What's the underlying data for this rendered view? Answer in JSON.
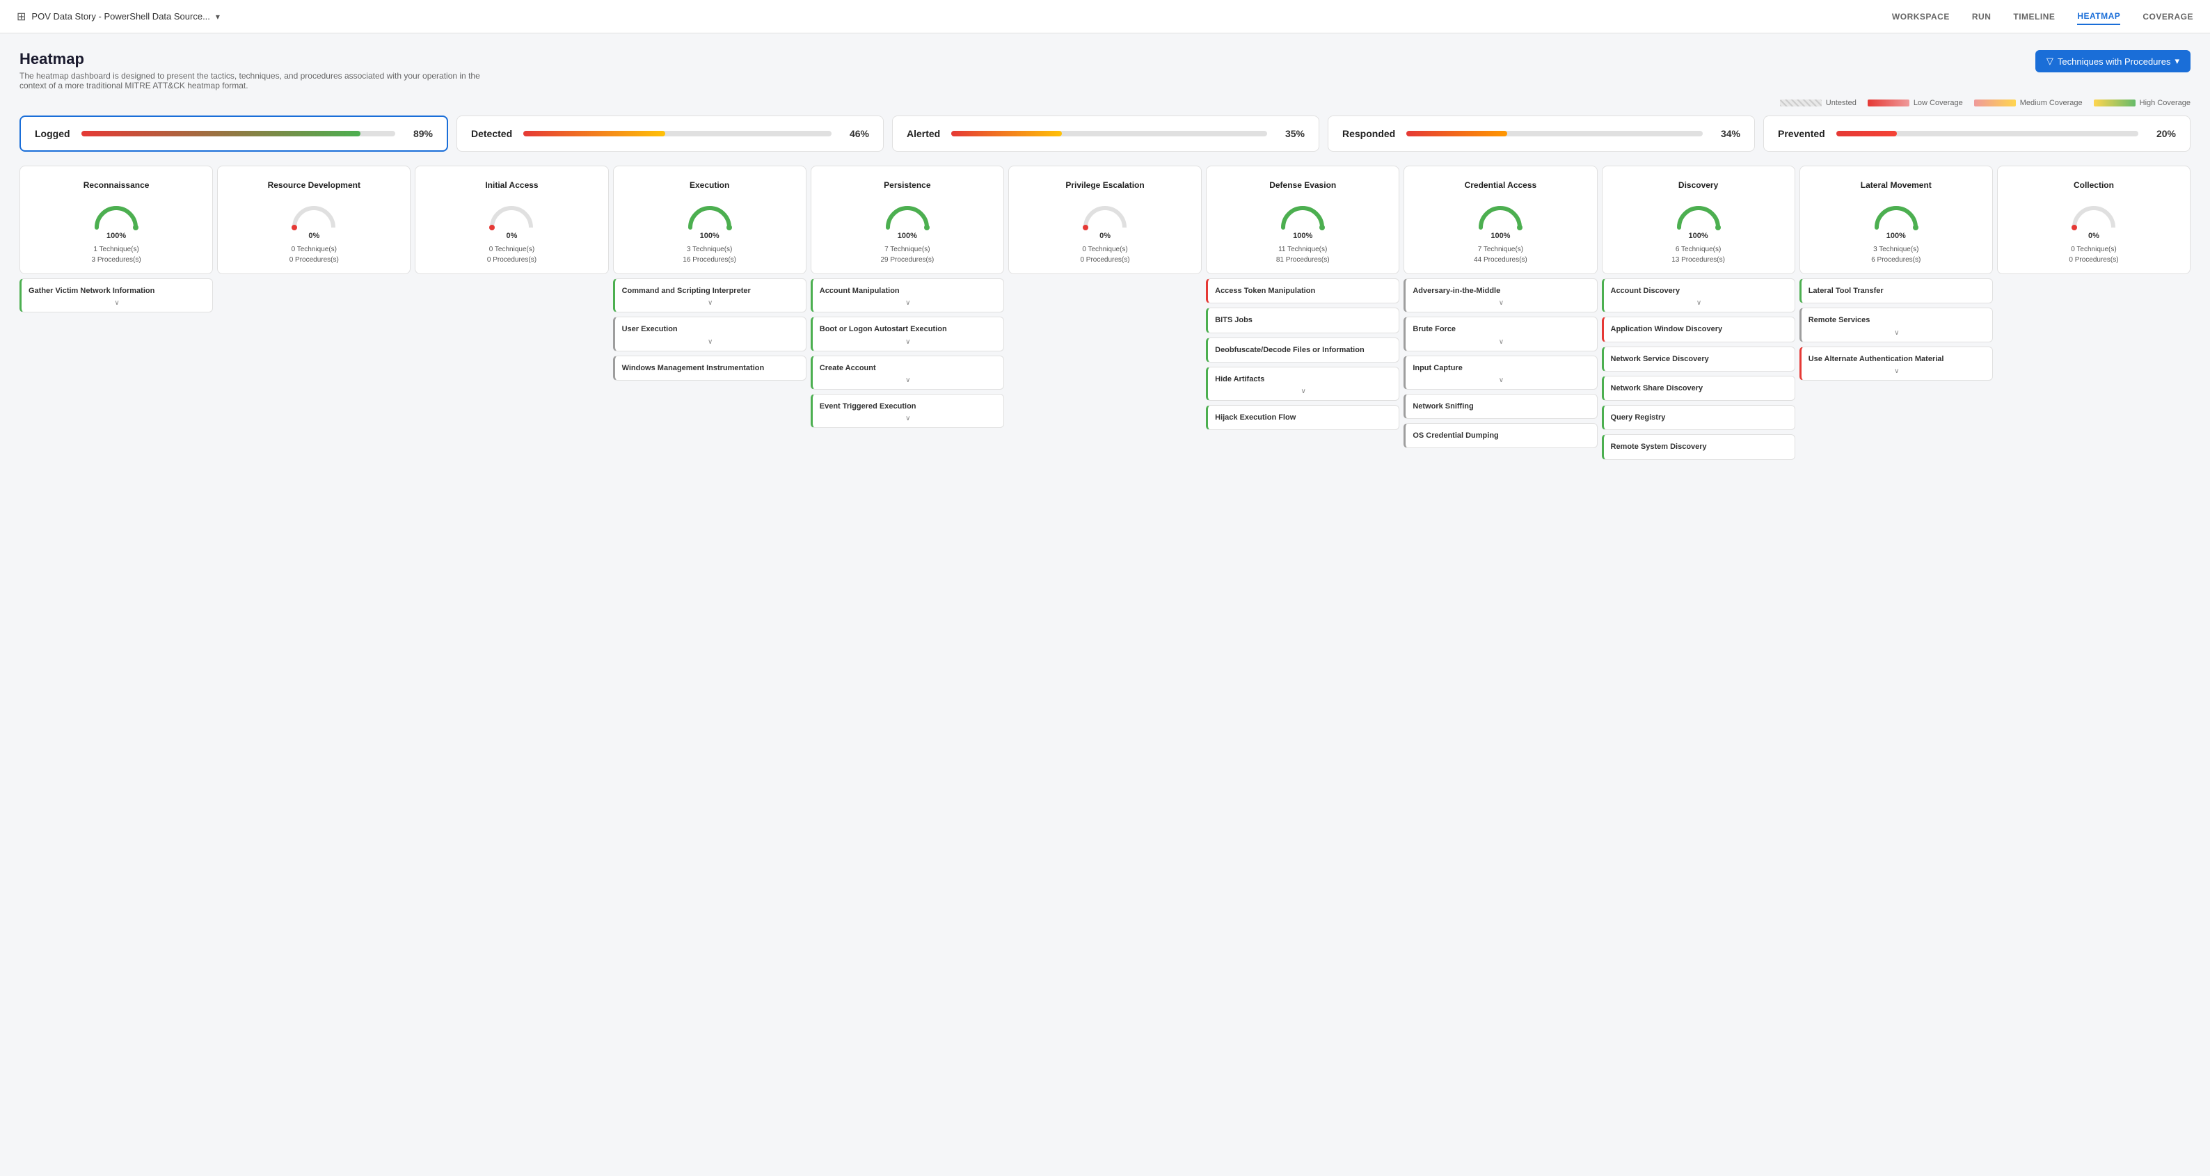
{
  "nav": {
    "app_title": "POV Data Story - PowerShell Data Source...",
    "links": [
      "WORKSPACE",
      "RUN",
      "TIMELINE",
      "HEATMAP",
      "COVERAGE"
    ],
    "active_link": "HEATMAP"
  },
  "page": {
    "title": "Heatmap",
    "subtitle": "The heatmap dashboard is designed to present the tactics, techniques, and procedures associated with your operation in the context of a more traditional MITRE ATT&CK heatmap format.",
    "filter_btn": "Techniques with Procedures"
  },
  "legend": [
    {
      "label": "Untested",
      "type": "untested"
    },
    {
      "label": "Low Coverage",
      "type": "low"
    },
    {
      "label": "Medium Coverage",
      "type": "medium"
    },
    {
      "label": "High Coverage",
      "type": "high"
    }
  ],
  "coverage_cards": [
    {
      "label": "Logged",
      "pct": 89,
      "color": "#4caf50",
      "active": true
    },
    {
      "label": "Detected",
      "pct": 46,
      "color": "#ffc107",
      "active": false
    },
    {
      "label": "Alerted",
      "pct": 35,
      "color": "#ffc107",
      "active": false
    },
    {
      "label": "Responded",
      "pct": 34,
      "color": "#ff9800",
      "active": false
    },
    {
      "label": "Prevented",
      "pct": 20,
      "color": "#f44336",
      "active": false
    }
  ],
  "tactics": [
    {
      "name": "Reconnaissance",
      "pct": 100,
      "pct_label": "100%",
      "gauge_color": "#4caf50",
      "techniques_count": "1 Technique(s)",
      "procedures_count": "3 Procedures(s)",
      "techniques": [
        {
          "name": "Gather Victim Network Information",
          "color": "green",
          "chevron": true
        }
      ]
    },
    {
      "name": "Resource Development",
      "pct": 0,
      "pct_label": "0%",
      "gauge_color": "#e0e0e0",
      "techniques_count": "0 Technique(s)",
      "procedures_count": "0 Procedures(s)",
      "techniques": []
    },
    {
      "name": "Initial Access",
      "pct": 0,
      "pct_label": "0%",
      "gauge_color": "#e0e0e0",
      "techniques_count": "0 Technique(s)",
      "procedures_count": "0 Procedures(s)",
      "techniques": []
    },
    {
      "name": "Execution",
      "pct": 100,
      "pct_label": "100%",
      "gauge_color": "#4caf50",
      "techniques_count": "3 Technique(s)",
      "procedures_count": "16 Procedures(s)",
      "techniques": [
        {
          "name": "Command and Scripting Interpreter",
          "color": "green",
          "chevron": true
        },
        {
          "name": "User Execution",
          "color": "gray",
          "chevron": true
        },
        {
          "name": "Windows Management Instrumentation",
          "color": "gray",
          "chevron": false
        }
      ]
    },
    {
      "name": "Persistence",
      "pct": 100,
      "pct_label": "100%",
      "gauge_color": "#4caf50",
      "techniques_count": "7 Technique(s)",
      "procedures_count": "29 Procedures(s)",
      "techniques": [
        {
          "name": "Account Manipulation",
          "color": "green",
          "chevron": true
        },
        {
          "name": "Boot or Logon Autostart Execution",
          "color": "green",
          "chevron": true
        },
        {
          "name": "Create Account",
          "color": "green",
          "chevron": true
        },
        {
          "name": "Event Triggered Execution",
          "color": "green",
          "chevron": true
        }
      ]
    },
    {
      "name": "Privilege Escalation",
      "pct": 0,
      "pct_label": "0%",
      "gauge_color": "#e0e0e0",
      "techniques_count": "0 Technique(s)",
      "procedures_count": "0 Procedures(s)",
      "techniques": []
    },
    {
      "name": "Defense Evasion",
      "pct": 100,
      "pct_label": "100%",
      "gauge_color": "#4caf50",
      "techniques_count": "11 Technique(s)",
      "procedures_count": "81 Procedures(s)",
      "techniques": [
        {
          "name": "Access Token Manipulation",
          "color": "red",
          "chevron": false
        },
        {
          "name": "BITS Jobs",
          "color": "green",
          "chevron": false
        },
        {
          "name": "Deobfuscate/Decode Files or Information",
          "color": "green",
          "chevron": false
        },
        {
          "name": "Hide Artifacts",
          "color": "green",
          "chevron": true
        },
        {
          "name": "Hijack Execution Flow",
          "color": "green",
          "chevron": false
        }
      ]
    },
    {
      "name": "Credential Access",
      "pct": 100,
      "pct_label": "100%",
      "gauge_color": "#4caf50",
      "techniques_count": "7 Technique(s)",
      "procedures_count": "44 Procedures(s)",
      "techniques": [
        {
          "name": "Adversary-in-the-Middle",
          "color": "gray",
          "chevron": true
        },
        {
          "name": "Brute Force",
          "color": "gray",
          "chevron": true
        },
        {
          "name": "Input Capture",
          "color": "gray",
          "chevron": true
        },
        {
          "name": "Network Sniffing",
          "color": "gray",
          "chevron": false
        },
        {
          "name": "OS Credential Dumping",
          "color": "gray",
          "chevron": false
        }
      ]
    },
    {
      "name": "Discovery",
      "pct": 100,
      "pct_label": "100%",
      "gauge_color": "#4caf50",
      "techniques_count": "6 Technique(s)",
      "procedures_count": "13 Procedures(s)",
      "techniques": [
        {
          "name": "Account Discovery",
          "color": "green",
          "chevron": true
        },
        {
          "name": "Application Window Discovery",
          "color": "red",
          "chevron": false
        },
        {
          "name": "Network Service Discovery",
          "color": "green",
          "chevron": false
        },
        {
          "name": "Network Share Discovery",
          "color": "green",
          "chevron": false
        },
        {
          "name": "Query Registry",
          "color": "green",
          "chevron": false
        },
        {
          "name": "Remote System Discovery",
          "color": "green",
          "chevron": false
        }
      ]
    },
    {
      "name": "Lateral Movement",
      "pct": 100,
      "pct_label": "100%",
      "gauge_color": "#4caf50",
      "techniques_count": "3 Technique(s)",
      "procedures_count": "6 Procedures(s)",
      "techniques": [
        {
          "name": "Lateral Tool Transfer",
          "color": "green",
          "chevron": false
        },
        {
          "name": "Remote Services",
          "color": "gray",
          "chevron": true
        },
        {
          "name": "Use Alternate Authentication Material",
          "color": "red",
          "chevron": true
        }
      ]
    },
    {
      "name": "Collection",
      "pct": 0,
      "pct_label": "0%",
      "gauge_color": "#e0e0e0",
      "techniques_count": "0 Technique(s)",
      "procedures_count": "0 Procedures(s)",
      "techniques": []
    }
  ]
}
